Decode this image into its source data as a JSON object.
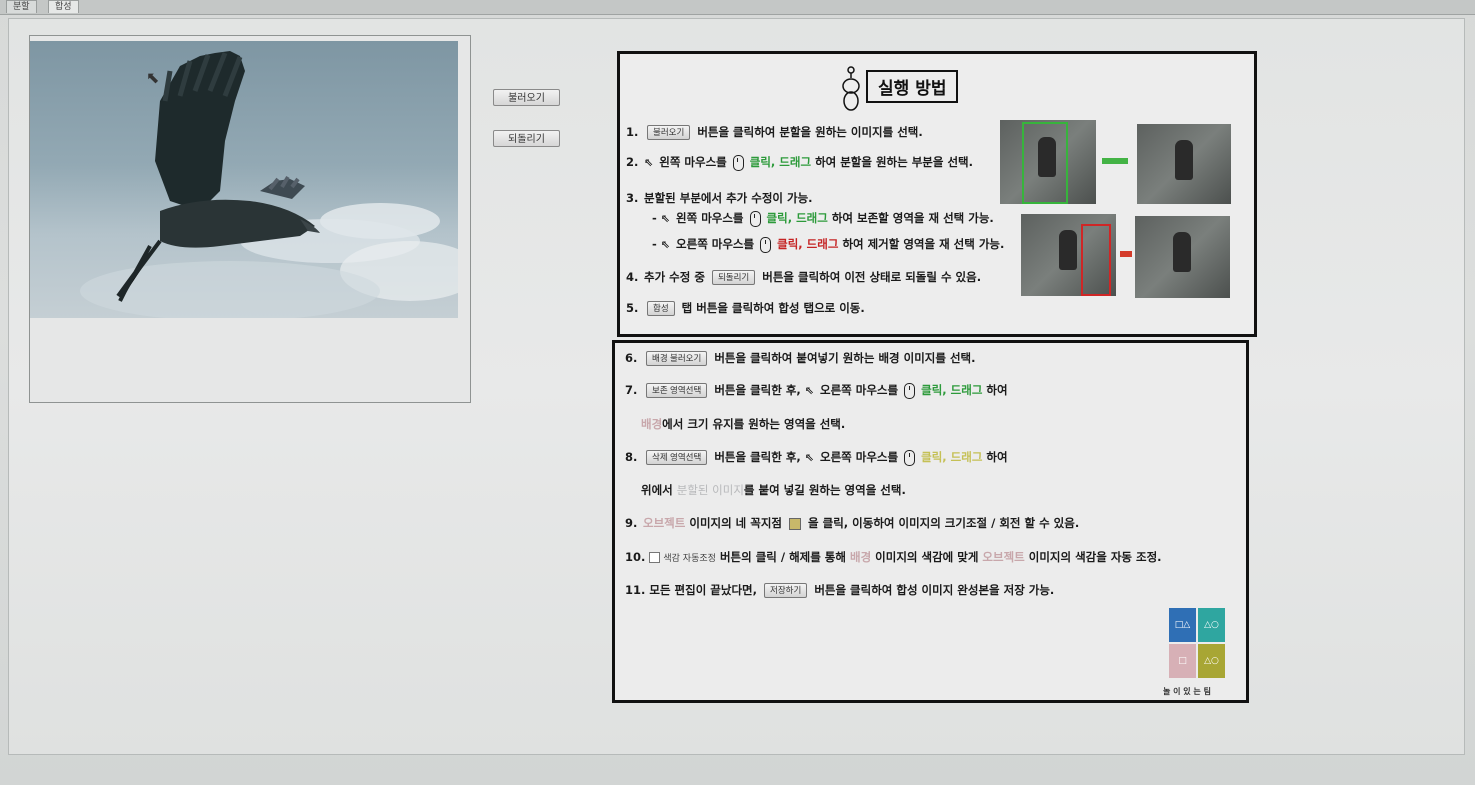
{
  "window": {
    "tabs": [
      {
        "label": "분할"
      },
      {
        "label": "합성"
      }
    ]
  },
  "toolbar": {
    "load_label": "불러오기",
    "undo_label": "되돌리기"
  },
  "guide": {
    "title": "실행 방법",
    "steps": [
      {
        "num": "1.",
        "btn": "불러오기",
        "text": "버튼을 클릭하여 분할을 원하는 이미지를 선택."
      },
      {
        "num": "2.",
        "pre": "왼쪽 마우스를",
        "click": "클릭, 드래그",
        "text": "하여 분할을 원하는 부분을 선택."
      },
      {
        "num": "3.",
        "text": "분할된 부분에서 추가 수정이 가능."
      },
      {
        "num": "-",
        "pre": "왼쪽 마우스를",
        "click": "클릭, 드래그",
        "text": "하여 보존할 영역을 재 선택 가능."
      },
      {
        "num": "-",
        "pre": "오른쪽 마우스를",
        "click": "클릭, 드래그",
        "text": "하여 제거할 영역을 재 선택 가능."
      },
      {
        "num": "4.",
        "pre": "추가 수정 중",
        "btn": "되돌리기",
        "text": "버튼을 클릭하여 이전 상태로 되돌릴 수 있음."
      },
      {
        "num": "5.",
        "btn": "합성",
        "text": "탭 버튼을 클릭하여 합성 탭으로 이동."
      }
    ],
    "steps2": [
      {
        "num": "6.",
        "btn": "배경 불러오기",
        "text": "버튼을 클릭하여 붙여넣기 원하는 배경 이미지를 선택."
      },
      {
        "num": "7.",
        "btn": "보존 영역선택",
        "pre": "버튼을 클릭한 후,",
        "mid": "오른쪽 마우스를",
        "click": "클릭, 드래그",
        "text": "하여"
      },
      {
        "lead": "배경",
        "text": "에서 크기 유지를 원하는 영역을 선택."
      },
      {
        "num": "8.",
        "btn": "삭제 영역선택",
        "pre": "버튼을 클릭한 후,",
        "mid": "오른쪽 마우스를",
        "click": "클릭, 드래그",
        "text": "하여"
      },
      {
        "pre": "위에서",
        "lead": "분할된 이미지",
        "text": "를 붙여 넣길 원하는 영역을 선택."
      },
      {
        "num": "9.",
        "lead": "오브젝트",
        "pre": "이미지의 네 꼭지점",
        "text": "을 클릭, 이동하여 이미지의 크기조절 / 회전 할 수 있음."
      },
      {
        "num": "10.",
        "btn": "색감 자동조정",
        "pre": "버튼의 클릭 / 해제를 통해",
        "lead": "배경",
        "mid": "이미지의 색감에 맞게",
        "lead2": "오브젝트",
        "text": "이미지의 색감을 자동 조정."
      },
      {
        "num": "11.",
        "pre": "모든 편집이 끝났다면,",
        "btn": "저장하기",
        "text": "버튼을 클릭하여 합성 이미지 완성본을 저장 가능."
      }
    ],
    "logo_caption": "놀 이 있 는 팀",
    "logo_glyphs": [
      "□△",
      "△○",
      "□",
      "△○"
    ]
  }
}
